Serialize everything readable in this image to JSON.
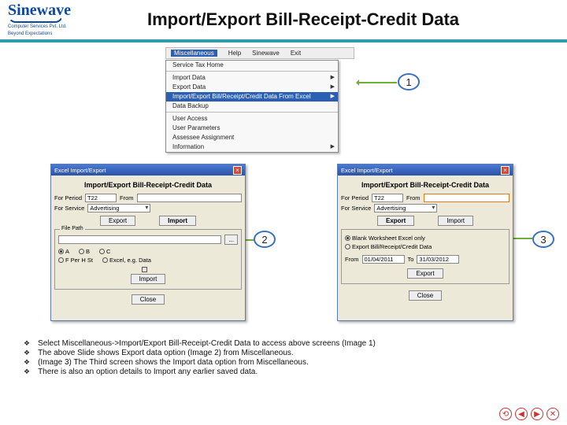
{
  "header": {
    "brand": "Sinewave",
    "brand_sub1": "Computer Services Pvt. Ltd.",
    "brand_sub2": "Beyond Expectations",
    "title": "Import/Export Bill-Receipt-Credit Data"
  },
  "menubar": {
    "items": [
      "Miscellaneous",
      "Help",
      "Sinewave",
      "Exit"
    ],
    "active_index": 0
  },
  "dropdown": {
    "items": [
      {
        "label": "Service Tax Home",
        "type": "item"
      },
      {
        "label": "",
        "type": "sep"
      },
      {
        "label": "Import Data",
        "type": "sub"
      },
      {
        "label": "Export Data",
        "type": "sub"
      },
      {
        "label": "Import/Export Bill/Receipt/Credit Data From Excel",
        "type": "sel sub"
      },
      {
        "label": "Data Backup",
        "type": "item"
      },
      {
        "label": "",
        "type": "sep"
      },
      {
        "label": "User Access",
        "type": "item"
      },
      {
        "label": "User Parameters",
        "type": "item"
      },
      {
        "label": "Assessee Assignment",
        "type": "item"
      },
      {
        "label": "Information",
        "type": "sub"
      }
    ]
  },
  "badges": {
    "b1": "1",
    "b2": "2",
    "b3": "3"
  },
  "dlg2": {
    "titlebar": "Excel Import/Export",
    "heading": "Import/Export Bill-Receipt-Credit Data",
    "lbl_for_period": "For Period",
    "val_period": "T22",
    "val_from": "From",
    "lbl_for_service": "For Service",
    "val_service": "Advertising",
    "btn_export": "Export",
    "btn_import": "Import",
    "grp_title": "File Path",
    "r_a": "A",
    "r_b": "B",
    "r_c": "C",
    "r_fph": "F Per H St",
    "r_exp": "Excel, e.g. Data",
    "chk_label": "",
    "btn_import2": "Import",
    "btn_close": "Close"
  },
  "dlg3": {
    "titlebar": "Excel Import/Export",
    "heading": "Import/Export Bill-Receipt-Credit Data",
    "lbl_for_period": "For Period",
    "val_period": "T22",
    "val_from": "From",
    "lbl_for_service": "For Service",
    "val_service": "Advertising",
    "btn_export": "Export",
    "btn_import": "Import",
    "r1": "Blank Worksheet Excel only",
    "r2": "Export Bill/Receipt/Credit Data",
    "lbl_fromdate": "From",
    "val_fromdate": "01/04/2011",
    "lbl_todate": "To",
    "val_todate": "31/03/2012",
    "btn_export2": "Export",
    "btn_close": "Close"
  },
  "notes": [
    "Select Miscellaneous->Import/Export Bill-Receipt-Credit Data to access above screens (Image 1)",
    "The above Slide shows Export data option (Image 2) from Miscellaneous.",
    "(Image 3) The Third screen shows the Import data option  from Miscellaneous.",
    "There is also an option details to Import any earlier saved data."
  ],
  "nav_icons": [
    "⟲",
    "◀",
    "▶",
    "✕"
  ]
}
